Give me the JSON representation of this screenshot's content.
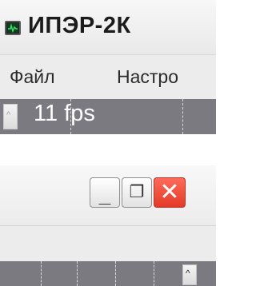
{
  "window": {
    "title": "ИПЭР-2К"
  },
  "menubar": {
    "file_label": "Файл",
    "settings_label": "Настро"
  },
  "plot": {
    "fps_text": "11 fps"
  },
  "window_controls": {
    "minimize_glyph": "_",
    "maximize_glyph": "❐",
    "close_glyph": "✕",
    "close_color": "#e23b26"
  },
  "scrollbar": {
    "up_arrow_glyph": "^"
  },
  "icons": [
    "app-icon",
    "minimize-icon",
    "maximize-icon",
    "close-icon",
    "scroll-up-icon"
  ]
}
